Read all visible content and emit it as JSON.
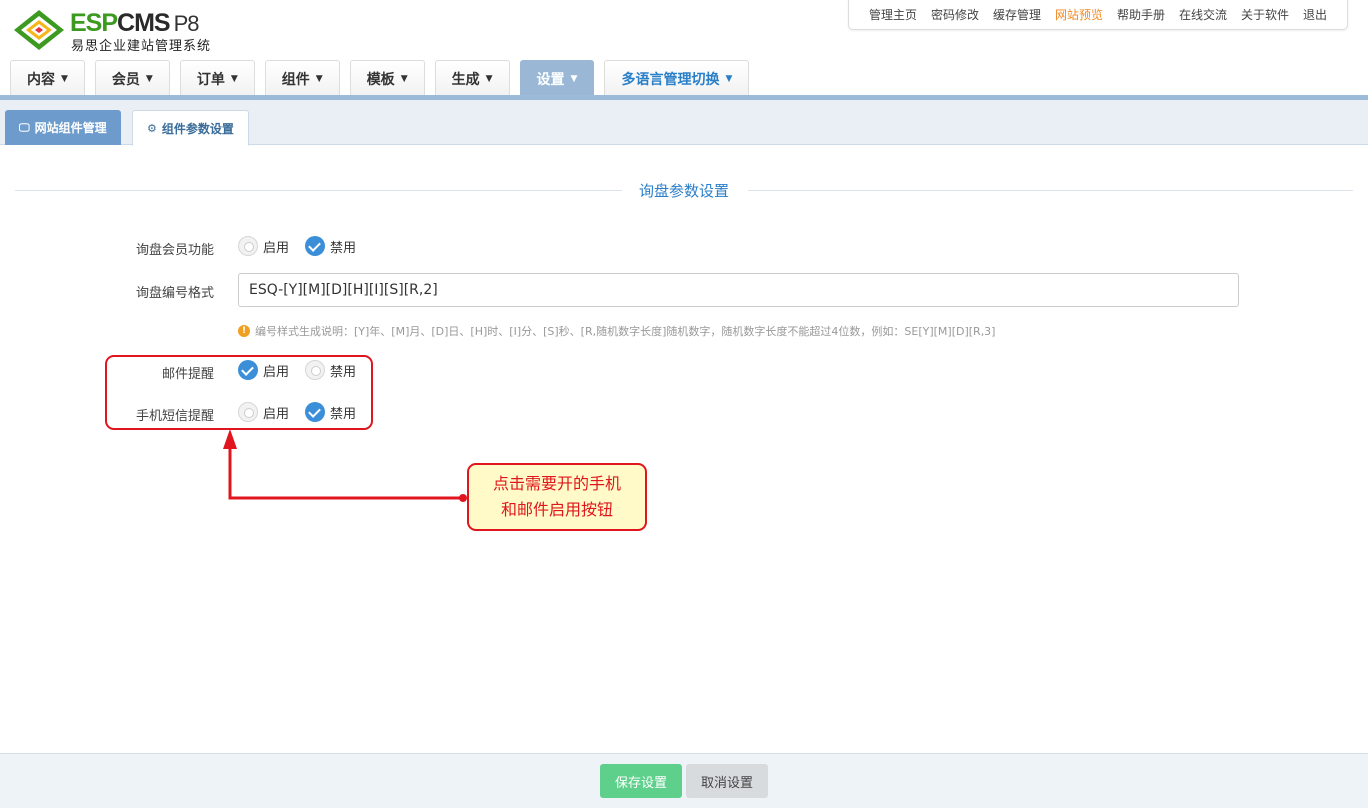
{
  "logo": {
    "brand_esp": "ESP",
    "brand_cms": "CMS",
    "version": "P8",
    "subtitle": "易思企业建站管理系统"
  },
  "topnav": [
    "管理主页",
    "密码修改",
    "缓存管理",
    "网站预览",
    "帮助手册",
    "在线交流",
    "关于软件",
    "退出"
  ],
  "mainnav": [
    "内容",
    "会员",
    "订单",
    "组件",
    "模板",
    "生成",
    "设置",
    "多语言管理切换"
  ],
  "subtabs": {
    "tab1": "网站组件管理",
    "tab2": "组件参数设置"
  },
  "section": {
    "title": "询盘参数设置"
  },
  "options": {
    "enable": "启用",
    "disable": "禁用"
  },
  "form": {
    "member_label": "询盘会员功能",
    "number_label": "询盘编号格式",
    "number_value": "ESQ-[Y][M][D][H][I][S][R,2]",
    "hint": "编号样式生成说明：[Y]年、[M]月、[D]日、[H]时、[I]分、[S]秒、[R,随机数字长度]随机数字，随机数字长度不能超过4位数，例如：SE[Y][M][D][R,3]",
    "email_label": "邮件提醒",
    "sms_label": "手机短信提醒"
  },
  "callout": {
    "line1": "点击需要开的手机",
    "line2": "和邮件启用按钮"
  },
  "buttons": {
    "save": "保存设置",
    "cancel": "取消设置"
  },
  "colors": {
    "accent": "#2a7fc9",
    "annotation": "#e0151d",
    "save": "#5fd08c"
  }
}
